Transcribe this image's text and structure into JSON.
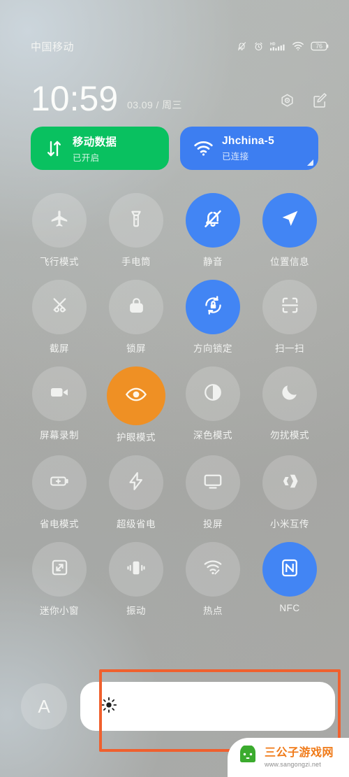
{
  "statusbar": {
    "carrier": "中国移动",
    "battery_level": "76",
    "icons": [
      "bell-off-icon",
      "alarm-clock-icon",
      "hd-signal-icon",
      "wifi-icon",
      "battery-icon"
    ]
  },
  "header": {
    "time": "10:59",
    "date": "03.09 / 周三",
    "settings_icon": "gear-icon",
    "edit_icon": "edit-icon"
  },
  "cards": [
    {
      "title": "移动数据",
      "subtitle": "已开启",
      "icon": "data-transfer-icon",
      "color": "#09c160",
      "active": true
    },
    {
      "title": "Jhchina-5",
      "subtitle": "已连接",
      "icon": "wifi-icon",
      "color": "#3d7ef1",
      "active": true
    }
  ],
  "toggles": [
    {
      "label": "飞行模式",
      "icon": "airplane-icon",
      "state": "off"
    },
    {
      "label": "手电筒",
      "icon": "flashlight-icon",
      "state": "off"
    },
    {
      "label": "静音",
      "icon": "bell-off-icon",
      "state": "on"
    },
    {
      "label": "位置信息",
      "icon": "location-arrow-icon",
      "state": "on"
    },
    {
      "label": "截屏",
      "icon": "screenshot-icon",
      "state": "off"
    },
    {
      "label": "锁屏",
      "icon": "lock-icon",
      "state": "off"
    },
    {
      "label": "方向锁定",
      "icon": "rotation-lock-icon",
      "state": "on"
    },
    {
      "label": "扫一扫",
      "icon": "scan-icon",
      "state": "off"
    },
    {
      "label": "屏幕录制",
      "icon": "video-camera-icon",
      "state": "off"
    },
    {
      "label": "护眼模式",
      "icon": "eye-icon",
      "state": "on-orange"
    },
    {
      "label": "深色模式",
      "icon": "contrast-icon",
      "state": "off"
    },
    {
      "label": "勿扰模式",
      "icon": "moon-icon",
      "state": "off"
    },
    {
      "label": "省电模式",
      "icon": "battery-plus-icon",
      "state": "off"
    },
    {
      "label": "超级省电",
      "icon": "lightning-icon",
      "state": "off"
    },
    {
      "label": "投屏",
      "icon": "cast-screen-icon",
      "state": "off"
    },
    {
      "label": "小米互传",
      "icon": "mi-share-icon",
      "state": "off"
    },
    {
      "label": "迷你小窗",
      "icon": "mini-window-icon",
      "state": "off"
    },
    {
      "label": "振动",
      "icon": "vibrate-icon",
      "state": "off"
    },
    {
      "label": "热点",
      "icon": "hotspot-icon",
      "state": "off"
    },
    {
      "label": "NFC",
      "icon": "nfc-icon",
      "state": "on"
    }
  ],
  "brightness": {
    "auto_label": "A",
    "slider_icon": "brightness-sun-icon",
    "fill_percent": 100
  },
  "annotation": {
    "color": "#f0602e",
    "target": "brightness-slider"
  },
  "watermark": {
    "title": "三公子游戏网",
    "url": "www.sangongzi.net",
    "logo": "android-mascot-icon"
  },
  "colors": {
    "accent_blue": "#4285f4",
    "accent_green": "#09c160",
    "accent_orange": "#ef9024",
    "annotation_orange": "#f0602e"
  }
}
